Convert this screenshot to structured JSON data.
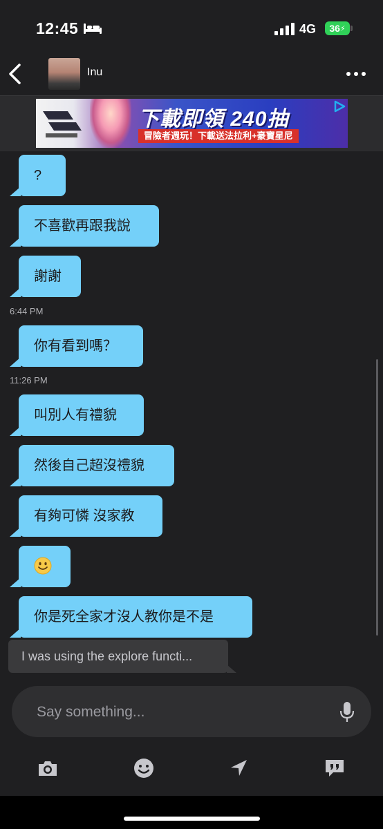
{
  "status": {
    "time": "12:45",
    "network": "4G",
    "battery": "36"
  },
  "header": {
    "contact_name": "Inu"
  },
  "ad": {
    "headline": "下載即領 240抽",
    "subline": "冒險者週玩！下載送法拉利+豪寶星尼"
  },
  "messages": [
    {
      "kind": "bubble",
      "text": "?"
    },
    {
      "kind": "bubble",
      "text": "不喜歡再跟我說"
    },
    {
      "kind": "bubble",
      "text": "謝謝"
    },
    {
      "kind": "time",
      "text": "6:44 PM"
    },
    {
      "kind": "bubble",
      "text": "你有看到嗎？"
    },
    {
      "kind": "time",
      "text": "11:26 PM"
    },
    {
      "kind": "bubble",
      "text": "叫別人有禮貌"
    },
    {
      "kind": "bubble",
      "text": "然後自己超沒禮貌"
    },
    {
      "kind": "bubble",
      "text": "有夠可憐 沒家教"
    },
    {
      "kind": "emoji",
      "text": "",
      "icon": "smiling-face-emoji"
    },
    {
      "kind": "bubble",
      "text": "你是死全家才沒人教你是不是"
    }
  ],
  "preview": {
    "text": "I was using the explore functi..."
  },
  "composer": {
    "placeholder": "Say something..."
  },
  "toolbar": {
    "icons": [
      "camera-icon",
      "emoji-icon",
      "location-icon",
      "quick-reply-icon"
    ]
  },
  "colors": {
    "background": "#1f1f21",
    "bubble": "#74d0f9",
    "input": "#2f2f31"
  }
}
